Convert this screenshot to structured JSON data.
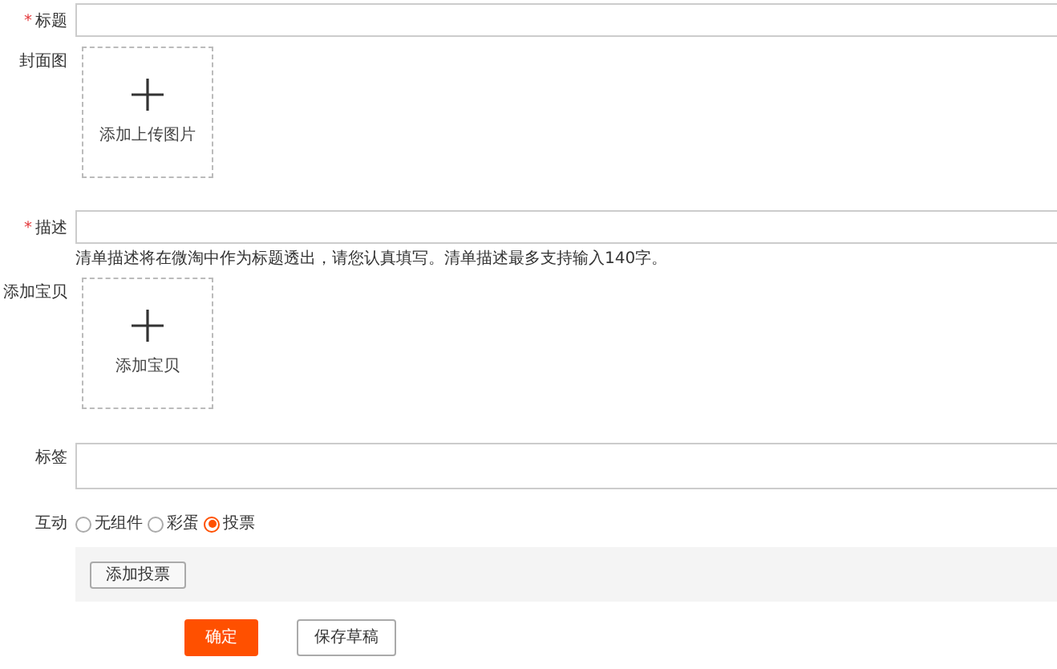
{
  "fields": [
    {
      "kind": "input",
      "label": "标题",
      "required_mark": "*"
    },
    {
      "kind": "upload",
      "label": "封面图",
      "upload_text": "添加上传图片"
    },
    {
      "kind": "input",
      "label": "描述",
      "required_mark": "*",
      "hint": "清单描述将在微淘中作为标题透出，请您认真填写。清单描述最多支持输入140字。"
    },
    {
      "kind": "upload",
      "label": "添加宝贝",
      "upload_text": "添加宝贝"
    },
    {
      "kind": "textarea",
      "label": "标签"
    },
    {
      "kind": "radio",
      "label": "互动",
      "options": [
        {
          "label": "无组件",
          "selected": false
        },
        {
          "label": "彩蛋",
          "selected": false
        },
        {
          "label": "投票",
          "selected": true
        }
      ],
      "panel_button": "添加投票"
    }
  ],
  "buttons": [
    {
      "label": "确定",
      "kind": "primary"
    },
    {
      "label": "保存草稿",
      "kind": "secondary"
    }
  ]
}
